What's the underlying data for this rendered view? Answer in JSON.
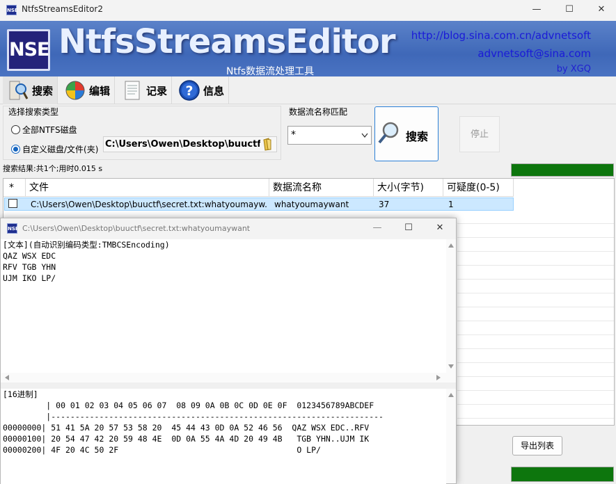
{
  "window": {
    "title": "NtfsStreamsEditor2",
    "app_icon_text": "NSE",
    "minimize_glyph": "—",
    "maximize_glyph": "☐",
    "close_glyph": "✕"
  },
  "banner": {
    "logo_text": "NSE",
    "app_name": "NtfsStreamsEditor",
    "subtitle": "Ntfs数据流处理工具",
    "blog_url": "http://blog.sina.com.cn/advnetsoft",
    "email": "advnetsoft@sina.com",
    "author": "by XGQ"
  },
  "toolbar": {
    "items": [
      {
        "label": "搜索",
        "icon": "magnifier-paper-icon"
      },
      {
        "label": "编辑",
        "icon": "colorful-globe-icon"
      },
      {
        "label": "记录",
        "icon": "notepad-icon"
      },
      {
        "label": "信息",
        "icon": "info-icon"
      }
    ]
  },
  "search_options": {
    "group_title": "选择搜索类型",
    "radio_all": "全部NTFS磁盘",
    "radio_custom": "自定义磁盘/文件(夹)",
    "selected": "custom",
    "path_value": "C:\\Users\\Owen\\Desktop\\buuctf",
    "match_title": "数据流名称匹配",
    "match_value": "*",
    "search_button": "搜索",
    "stop_button": "停止"
  },
  "status": {
    "result_text": "搜索结果:共1个;用时0.015 s",
    "progress_color": "#0d760d"
  },
  "table": {
    "columns": [
      "*",
      "文件",
      "数据流名称",
      "大小(字节)",
      "可疑度(0-5)"
    ],
    "rows": [
      {
        "checked": false,
        "file": "C:\\Users\\Owen\\Desktop\\buuctf\\secret.txt:whatyoumayw...",
        "stream": "whatyoumaywant",
        "size": "37",
        "suspicion": "1"
      }
    ]
  },
  "sub_window": {
    "title": "C:\\Users\\Owen\\Desktop\\buuctf\\secret.txt:whatyoumaywant",
    "text_header": "[文本](自动识别编码类型:TMBCSEncoding)",
    "text_lines": [
      "QAZ WSX EDC",
      "RFV TGB YHN",
      "UJM IKO LP/"
    ],
    "hex_header": "[16进制]",
    "hex_col_header": "         | 00 01 02 03 04 05 06 07  08 09 0A 0B 0C 0D 0E 0F  0123456789ABCDEF",
    "hex_separator": "         |---------------------------------------------------------------------",
    "hex_rows": [
      "00000000| 51 41 5A 20 57 53 58 20  45 44 43 0D 0A 52 46 56  QAZ WSX EDC..RFV",
      "00000100| 20 54 47 42 20 59 48 4E  0D 0A 55 4A 4D 20 49 4B   TGB YHN..UJM IK",
      "00000200| 4F 20 4C 50 2F                                     O LP/"
    ]
  },
  "export_button": "导出列表",
  "colors": {
    "banner": "#4a73c2",
    "selection": "#cce8ff",
    "accent": "#2a7fd6",
    "link": "#1a1ad8"
  }
}
